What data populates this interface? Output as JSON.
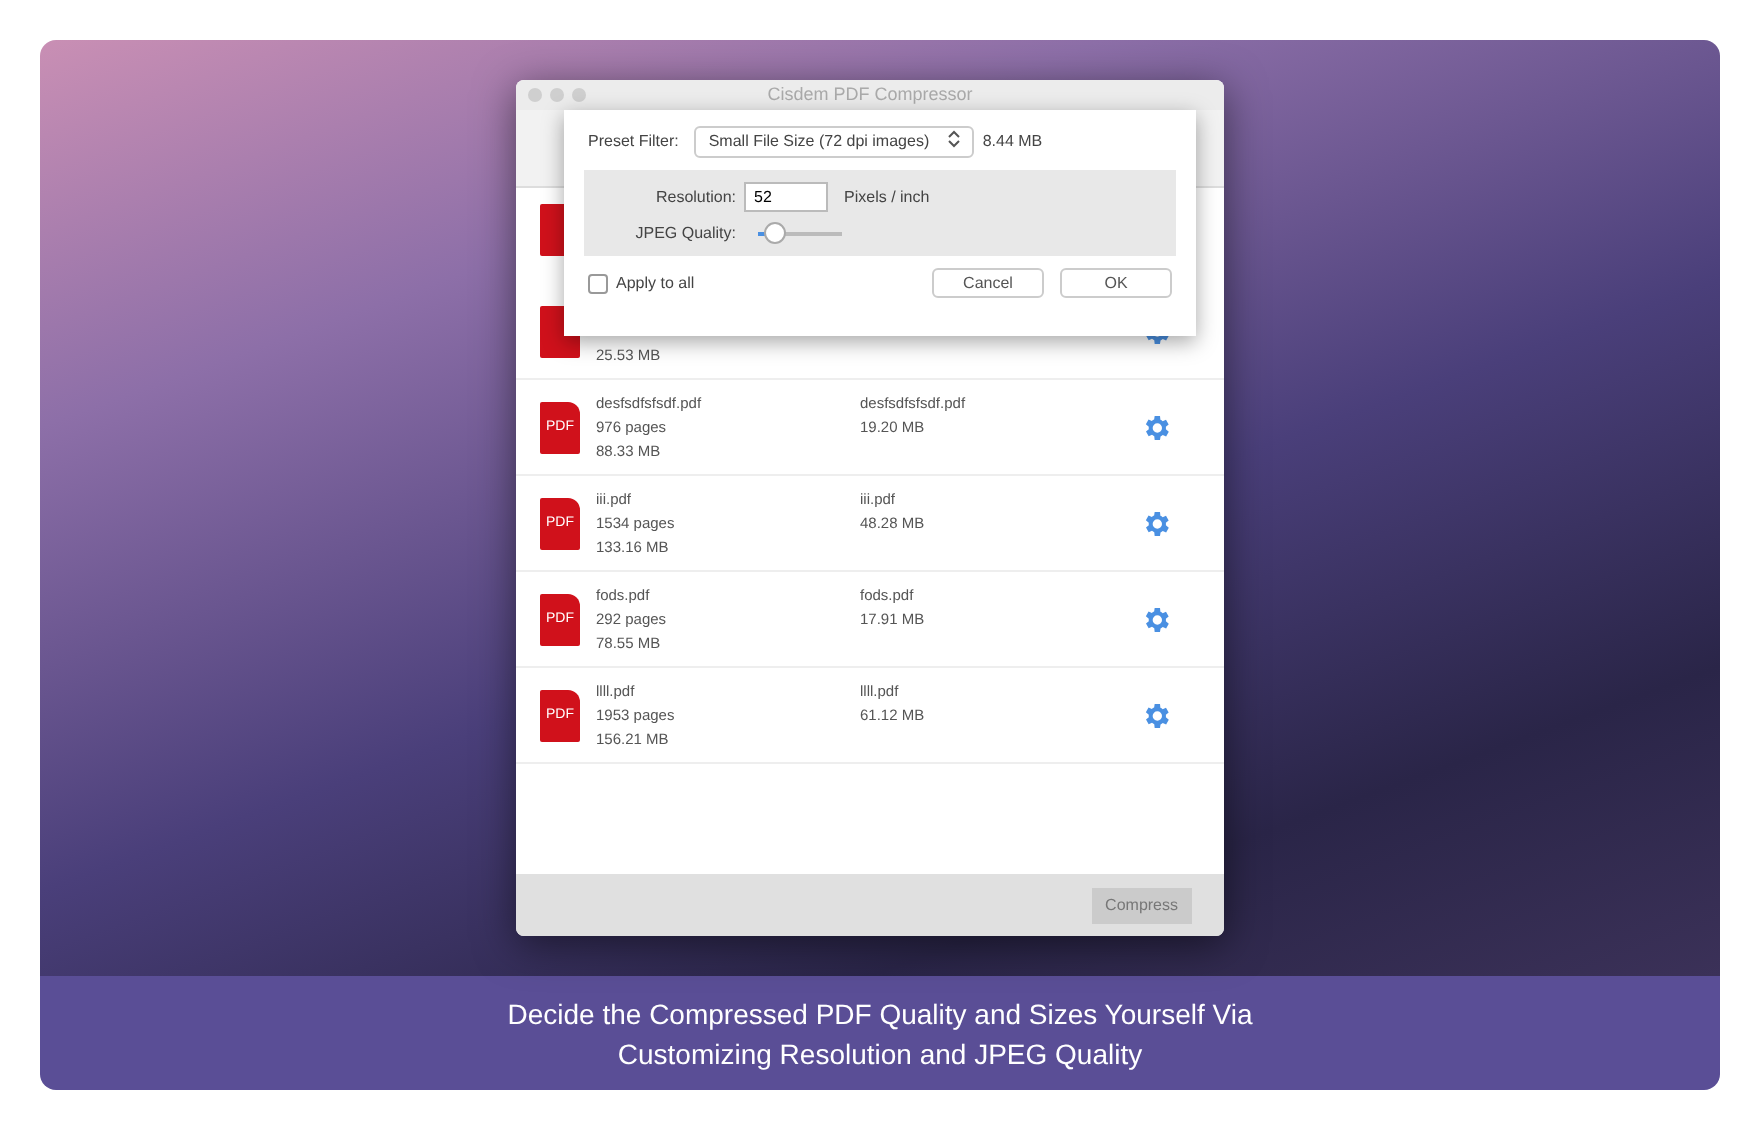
{
  "window": {
    "title": "Cisdem PDF Compressor"
  },
  "dialog": {
    "preset_label": "Preset Filter:",
    "preset_value": "Small File Size (72 dpi images)",
    "estimated_size": "8.44 MB",
    "resolution_label": "Resolution:",
    "resolution_value": "52",
    "resolution_unit": "Pixels / inch",
    "quality_label": "JPEG Quality:",
    "quality": {
      "level": 0.2
    },
    "apply_all": {
      "label": "Apply to all",
      "checked": false
    },
    "buttons": [
      "Cancel",
      "OK"
    ]
  },
  "files": [
    {
      "original_size": "25.53 MB"
    },
    {
      "icon_label": "PDF",
      "name": "desfsdfsfsdf.pdf",
      "pages": "976 pages",
      "original_size": "88.33 MB",
      "output_name": "desfsdfsfsdf.pdf",
      "output_size": "19.20 MB"
    },
    {
      "icon_label": "PDF",
      "name": "iii.pdf",
      "pages": "1534 pages",
      "original_size": "133.16 MB",
      "output_name": "iii.pdf",
      "output_size": "48.28 MB"
    },
    {
      "icon_label": "PDF",
      "name": "fods.pdf",
      "pages": "292 pages",
      "original_size": "78.55 MB",
      "output_name": "fods.pdf",
      "output_size": "17.91 MB"
    },
    {
      "icon_label": "PDF",
      "name": "llll.pdf",
      "pages": "1953 pages",
      "original_size": "156.21 MB",
      "output_name": "llll.pdf",
      "output_size": "61.12 MB"
    }
  ],
  "compress_button": "Compress",
  "caption": {
    "lines": [
      "Decide the Compressed PDF Quality and Sizes Yourself Via",
      "Customizing Resolution and JPEG Quality"
    ]
  }
}
